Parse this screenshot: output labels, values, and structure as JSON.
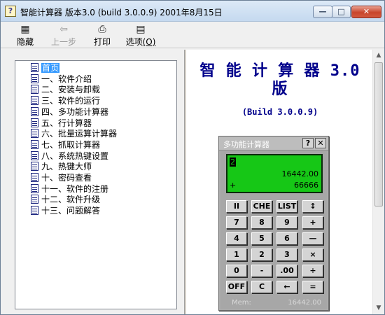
{
  "window": {
    "title": "智能计算器 版本3.0 (build 3.0.0.9) 2001年8月15日",
    "controls": {
      "minimize": "—",
      "maximize": "□",
      "close": "✕"
    }
  },
  "toolbar": {
    "hide": {
      "label": "隐藏",
      "icon": "hide-panel-icon",
      "glyph": "▦"
    },
    "back": {
      "label": "上一步",
      "icon": "back-arrow-icon",
      "glyph": "⇦"
    },
    "print": {
      "label": "打印",
      "icon": "printer-icon",
      "glyph": "⎙"
    },
    "options": {
      "label": "选项",
      "accel": "(O)",
      "icon": "options-icon",
      "glyph": "▤"
    }
  },
  "tree": {
    "items": [
      "首页",
      "一、软件介绍",
      "二、安装与卸载",
      "三、软件的运行",
      "四、多功能计算器",
      "五、行计算器",
      "六、批量运算计算器",
      "七、抓取计算器",
      "八、系统热键设置",
      "九、热键大师",
      "十、密码查看",
      "十一、软件的注册",
      "十二、软件升级",
      "十三、问题解答"
    ],
    "selected_index": 0
  },
  "document": {
    "title": "智 能 计 算 器 3.0 版",
    "build": "(Build 3.0.0.9)"
  },
  "calculator": {
    "title": "多功能计算器",
    "help": "?",
    "close": "✕",
    "display": {
      "entry": "2",
      "value": "16442.00",
      "operator": "+",
      "memory": "66666"
    },
    "keys": [
      [
        "II",
        "CHE",
        "LIST",
        "↕"
      ],
      [
        "7",
        "8",
        "9",
        "+"
      ],
      [
        "4",
        "5",
        "6",
        "—"
      ],
      [
        "1",
        "2",
        "3",
        "×"
      ],
      [
        "0",
        "-",
        ".00",
        "÷"
      ],
      [
        "OFF",
        "C",
        "←",
        "="
      ]
    ],
    "mem_label": "Mem:",
    "mem_value": "16442.00"
  },
  "colors": {
    "doc_title": "#00008b",
    "display_bg": "#16c716",
    "selection": "#3399ff"
  }
}
